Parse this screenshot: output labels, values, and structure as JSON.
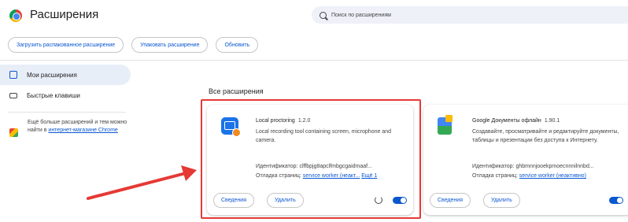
{
  "header": {
    "title": "Расширения",
    "search_placeholder": "Поиск по расширениям"
  },
  "toolbar": {
    "load_unpacked": "Загрузить распакованное расширение",
    "pack": "Упаковать расширение",
    "update": "Обновить"
  },
  "sidebar": {
    "items": [
      {
        "label": "Мои расширения",
        "icon": "puzzle-icon",
        "active": true
      },
      {
        "label": "Быстрые клавиши",
        "icon": "keyboard-icon",
        "active": false
      }
    ],
    "store_text": "Ещё больше расширений и тем можно найти в",
    "store_link": "интернет-магазине Chrome"
  },
  "main": {
    "section_title": "Все расширения",
    "cards": [
      {
        "name": "Local proctoring",
        "version": "1.2.0",
        "description": "Local recording tool containing screen, microphone and camera.",
        "id_label": "Идентификатор:",
        "id_value": "clffbpjg8apclfmbgcgaidmaaf...",
        "debug_label": "Отладка страниц:",
        "debug_link": "service worker (неакт...",
        "more_link": "Ещё 1",
        "details_button": "Сведения",
        "remove_button": "Удалить",
        "enabled": true
      },
      {
        "name": "Google Документы офлайн",
        "version": "1.90.1",
        "description": "Создавайте, просматривайте и редактируйте документы, таблицы и презентации без доступа к Интернету.",
        "id_label": "Идентификатор:",
        "id_value": "ghbmnnjooekpmoecnnnilnnbd...",
        "debug_label": "Отладка страниц:",
        "debug_link": "service worker (неактивно)",
        "details_button": "Сведения",
        "remove_button": "Удалить",
        "enabled": true
      }
    ]
  },
  "colors": {
    "accent": "#0b57d0",
    "highlight": "#e53935"
  }
}
